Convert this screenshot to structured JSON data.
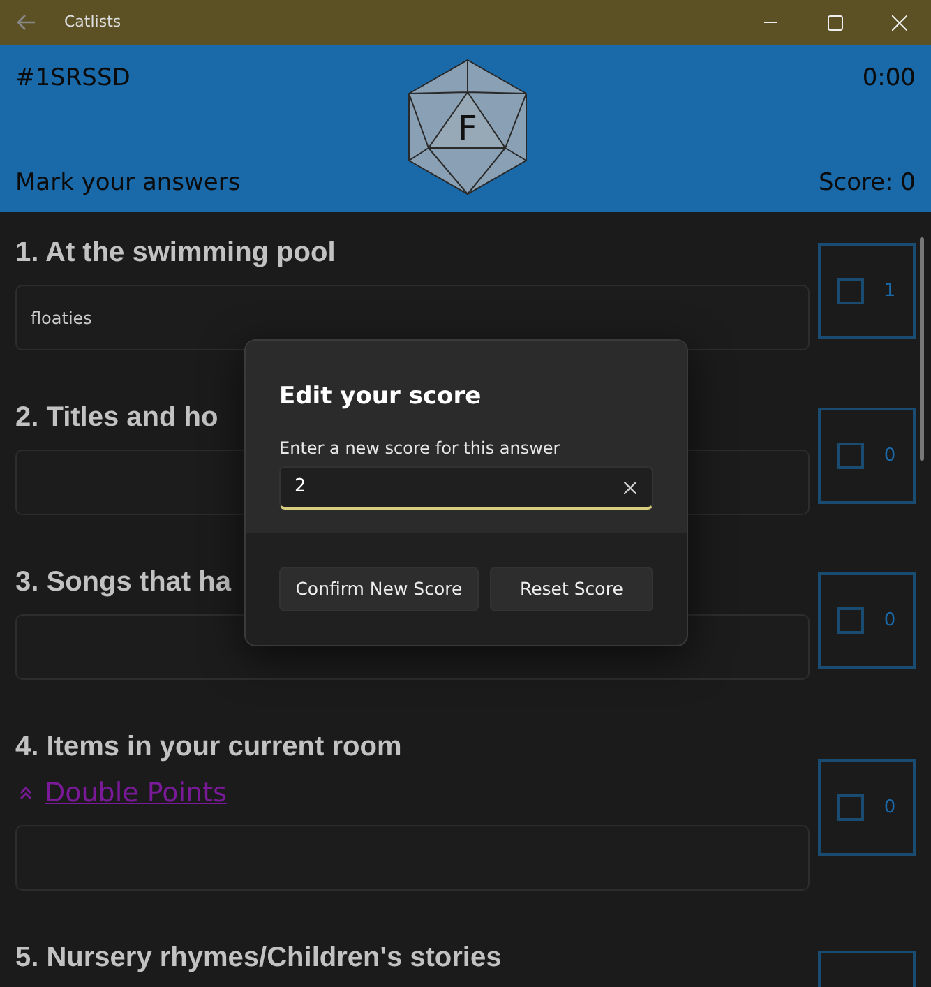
{
  "window": {
    "title": "Catlists"
  },
  "header": {
    "code": "#1SRSSD",
    "timer": "0:00",
    "die_letter": "F",
    "prompt": "Mark your answers",
    "score": "Score: 0"
  },
  "questions": [
    {
      "title": "1. At the swimming pool",
      "answer": "floaties",
      "score_box": {
        "checked": false,
        "count": "1"
      }
    },
    {
      "title": "2. Titles and ho",
      "score_box": {
        "checked": false,
        "count": "0"
      }
    },
    {
      "title": "3. Songs that ha",
      "score_box": {
        "checked": false,
        "count": "0"
      }
    },
    {
      "title": "4. Items in your current room",
      "bonus": "Double Points",
      "score_box": {
        "checked": false,
        "count": "0"
      }
    },
    {
      "title": "5. Nursery rhymes/Children's stories"
    }
  ],
  "dialog": {
    "title": "Edit your score",
    "field_label": "Enter a new score for this answer",
    "value": "2",
    "buttons": [
      "Confirm New Score",
      "Reset Score"
    ]
  }
}
